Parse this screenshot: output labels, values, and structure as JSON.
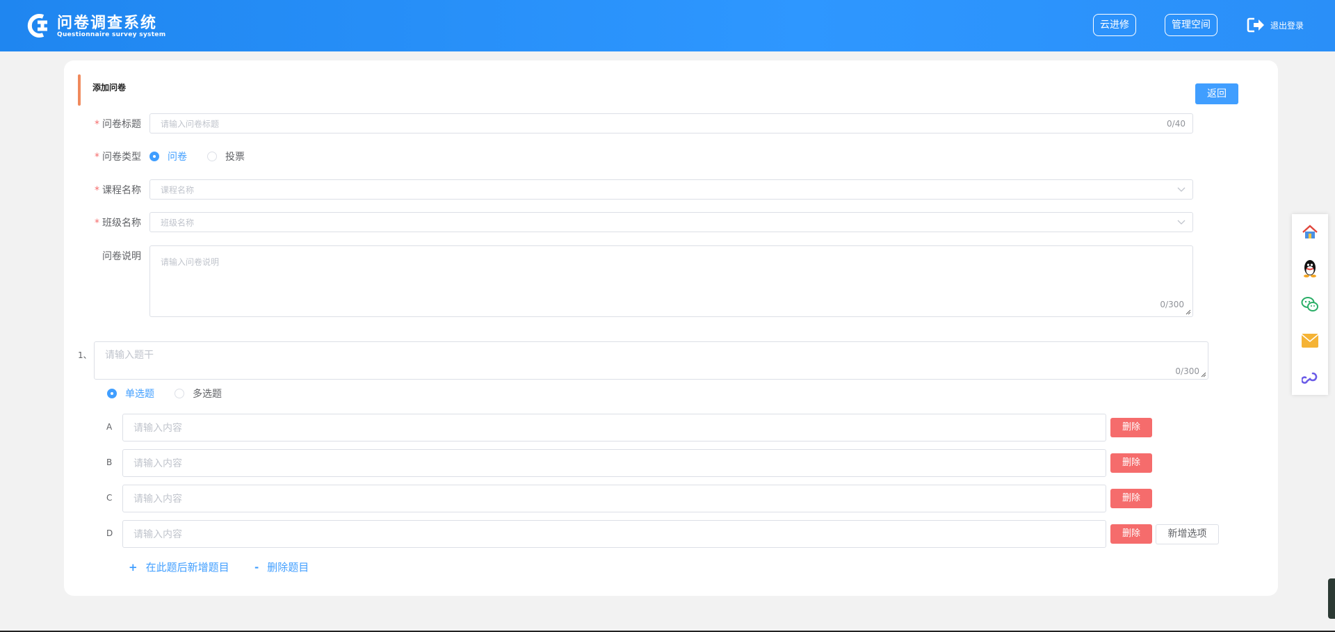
{
  "header": {
    "title": "问卷调查系统",
    "subtitle": "Questionnaire survey system",
    "btn_cloud": "云进修",
    "btn_manage": "管理空间",
    "logout": "退出登录"
  },
  "form": {
    "section_title": "添加问卷",
    "back": "返回",
    "title_label": "问卷标题",
    "title_placeholder": "请输入问卷标题",
    "title_count": "0/40",
    "type_label": "问卷类型",
    "type_options": [
      "问卷",
      "投票"
    ],
    "type_selected": "问卷",
    "course_label": "课程名称",
    "course_placeholder": "课程名称",
    "class_label": "班级名称",
    "class_placeholder": "班级名称",
    "desc_label": "问卷说明",
    "desc_placeholder": "请输入问卷说明",
    "desc_count": "0/300"
  },
  "question": {
    "number": "1、",
    "stem_placeholder": "请输入题干",
    "stem_count": "0/300",
    "kind_options": [
      "单选题",
      "多选题"
    ],
    "kind_selected": "单选题",
    "options": [
      {
        "letter": "A",
        "placeholder": "请输入内容",
        "delete": "删除"
      },
      {
        "letter": "B",
        "placeholder": "请输入内容",
        "delete": "删除"
      },
      {
        "letter": "C",
        "placeholder": "请输入内容",
        "delete": "删除"
      },
      {
        "letter": "D",
        "placeholder": "请输入内容",
        "delete": "删除"
      }
    ],
    "add_option": "新增选项",
    "add_question": "在此题后新增题目",
    "delete_question": "删除题目"
  },
  "float_bar": [
    "home-icon",
    "qq-icon",
    "wechat-icon",
    "mail-icon",
    "link-icon"
  ],
  "colors": {
    "primary": "#409eff",
    "danger": "#f56c6c",
    "accent": "#f08a5d",
    "header": "#2e97ff"
  }
}
